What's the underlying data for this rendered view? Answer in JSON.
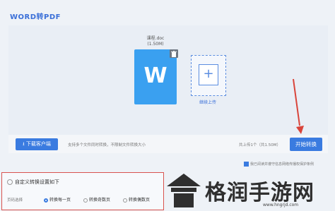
{
  "app": {
    "title": "WORD转PDF"
  },
  "file": {
    "name": "课程.doc",
    "size": "(1.50M)",
    "icon_letter": "W",
    "delete_icon": "trash-icon"
  },
  "add": {
    "label": "继续上传",
    "icon": "plus-icon"
  },
  "toolbar": {
    "download_label": "下载客户端",
    "hint": "支持多个文件同时转换，不限制文件转换大小",
    "count": "共上传1个（共1.50M）",
    "start_label": "开始转换"
  },
  "agree": {
    "text": "我已阅读并遵守信息网络传播权保护条例"
  },
  "settings": {
    "title": "自定义转换设置如下",
    "page_label": "页码选择",
    "options": [
      {
        "label": "转换每一页",
        "selected": true
      },
      {
        "label": "转换奇数页",
        "selected": false
      },
      {
        "label": "转换偶数页",
        "selected": false
      }
    ]
  },
  "watermark": {
    "text": "格润手游网",
    "url": "www.hngrjd.com"
  },
  "colors": {
    "accent": "#3a7be0",
    "file_icon": "#3aa0f0",
    "highlight": "#d9534f"
  }
}
